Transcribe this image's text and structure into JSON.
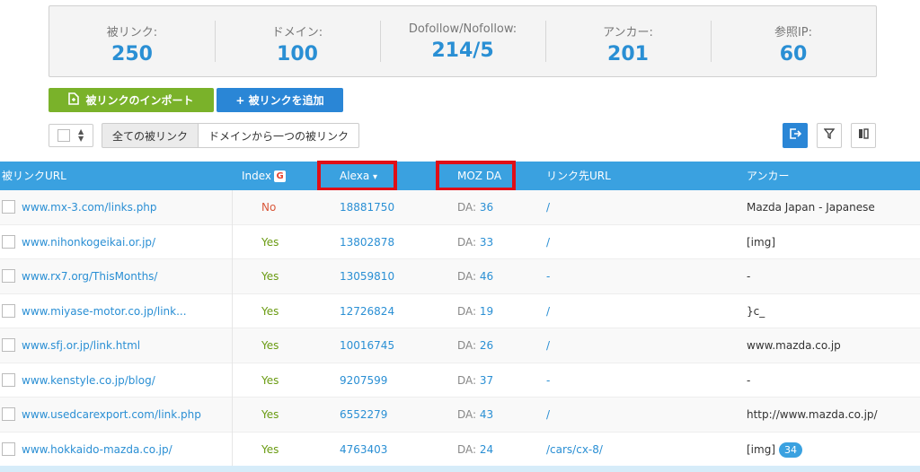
{
  "stats": [
    {
      "label": "被リンク:",
      "value": "250"
    },
    {
      "label": "ドメイン:",
      "value": "100"
    },
    {
      "label": "Dofollow/Nofollow:",
      "value": "214/5"
    },
    {
      "label": "アンカー:",
      "value": "201"
    },
    {
      "label": "参照IP:",
      "value": "60"
    }
  ],
  "actions": {
    "import_label": "被リンクのインポート",
    "add_label": "+ 被リンクを追加"
  },
  "filters": {
    "all_label": "全ての被リンク",
    "domain_label": "ドメインから一つの被リンク"
  },
  "table": {
    "headers": {
      "url": "被リンクURL",
      "index": "Index",
      "alexa": "Alexa",
      "moz": "MOZ DA",
      "target": "リンク先URL",
      "anchor": "アンカー"
    },
    "google_glyph": "G",
    "sort_glyph": "▾",
    "rows": [
      {
        "url": "www.mx-3.com/links.php",
        "index": "No",
        "alexa": "18881750",
        "da_prefix": "DA:",
        "da": "36",
        "target": "/",
        "anchor": "Mazda Japan - Japanese",
        "badge": ""
      },
      {
        "url": "www.nihonkogeikai.or.jp/",
        "index": "Yes",
        "alexa": "13802878",
        "da_prefix": "DA:",
        "da": "33",
        "target": "/",
        "anchor": "[img]",
        "badge": ""
      },
      {
        "url": "www.rx7.org/ThisMonths/",
        "index": "Yes",
        "alexa": "13059810",
        "da_prefix": "DA:",
        "da": "46",
        "target": "-",
        "anchor": "-",
        "badge": ""
      },
      {
        "url": "www.miyase-motor.co.jp/link...",
        "index": "Yes",
        "alexa": "12726824",
        "da_prefix": "DA:",
        "da": "19",
        "target": "/",
        "anchor": "}c_",
        "badge": ""
      },
      {
        "url": "www.sfj.or.jp/link.html",
        "index": "Yes",
        "alexa": "10016745",
        "da_prefix": "DA:",
        "da": "26",
        "target": "/",
        "anchor": "www.mazda.co.jp",
        "badge": ""
      },
      {
        "url": "www.kenstyle.co.jp/blog/",
        "index": "Yes",
        "alexa": "9207599",
        "da_prefix": "DA:",
        "da": "37",
        "target": "-",
        "anchor": "-",
        "badge": ""
      },
      {
        "url": "www.usedcarexport.com/link.php",
        "index": "Yes",
        "alexa": "6552279",
        "da_prefix": "DA:",
        "da": "43",
        "target": "/",
        "anchor": "http://www.mazda.co.jp/",
        "badge": ""
      },
      {
        "url": "www.hokkaido-mazda.co.jp/",
        "index": "Yes",
        "alexa": "4763403",
        "da_prefix": "DA:",
        "da": "24",
        "target": "/cars/cx-8/",
        "anchor": "[img]",
        "badge": "34"
      }
    ]
  },
  "colors": {
    "accent": "#2a86d6",
    "header_bg": "#3aa1e0",
    "import_green": "#7ab22a",
    "highlight_red": "#e00e17"
  }
}
